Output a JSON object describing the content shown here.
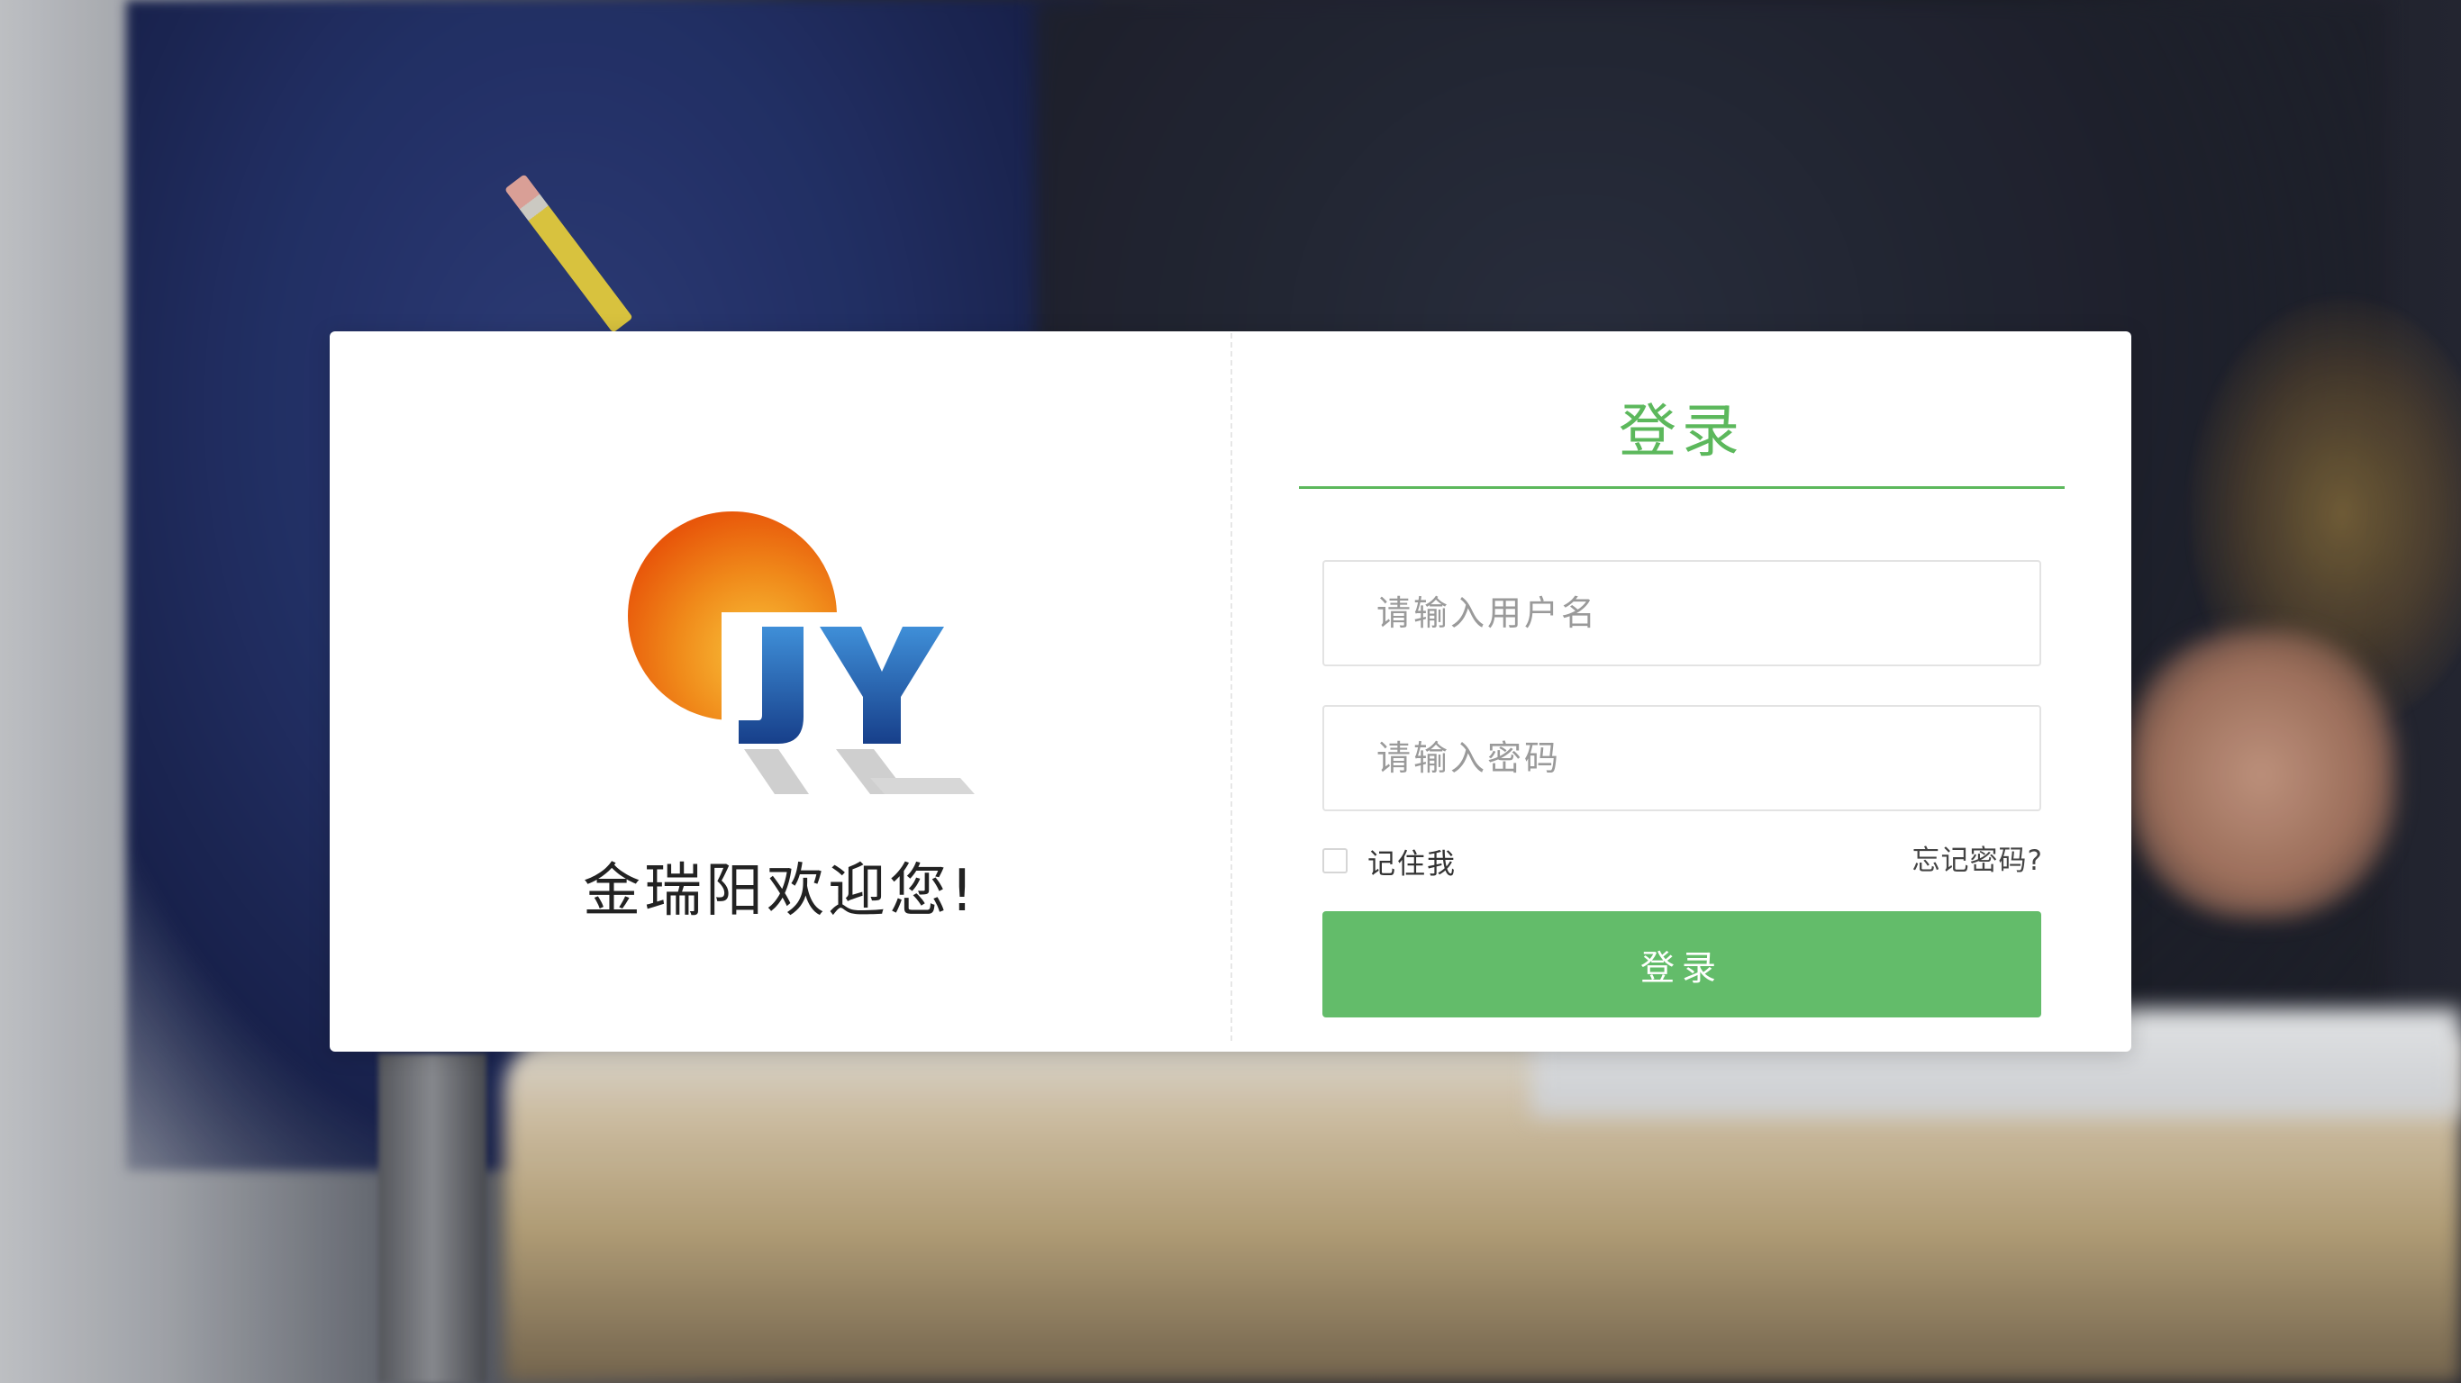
{
  "brand": {
    "welcome_text": "金瑞阳欢迎您!",
    "logo_text": "JY",
    "logo_colors": {
      "sun_light": "#f9c33b",
      "sun_dark": "#e8560a",
      "letters_light": "#3f8fd8",
      "letters_dark": "#173f8a",
      "shadow": "#cfcfcf"
    }
  },
  "login": {
    "title": "登录",
    "username_placeholder": "请输入用户名",
    "password_placeholder": "请输入密码",
    "remember_label": "记住我",
    "forgot_label": "忘记密码?",
    "submit_label": "登录"
  },
  "theme": {
    "accent": "#5cb85c",
    "button": "#63bc6a"
  }
}
